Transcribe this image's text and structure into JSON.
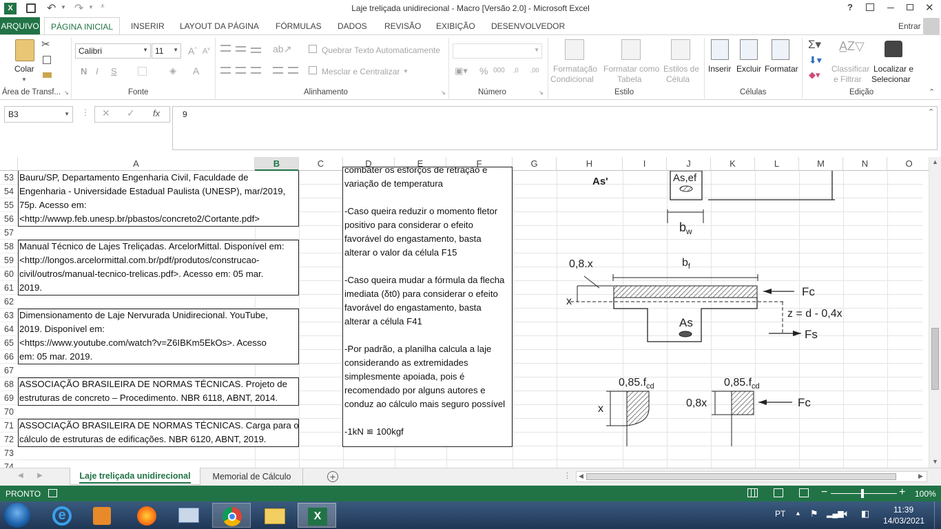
{
  "window": {
    "title": "Laje treliçada unidirecional - Macro [Versão 2.0] - Microsoft Excel",
    "signin": "Entrar"
  },
  "ribbon_tabs": [
    "ARQUIVO",
    "PÁGINA INICIAL",
    "INSERIR",
    "LAYOUT DA PÁGINA",
    "FÓRMULAS",
    "DADOS",
    "REVISÃO",
    "EXIBIÇÃO",
    "DESENVOLVEDOR"
  ],
  "ribbon": {
    "paste": "Colar",
    "font_name": "Calibri",
    "font_size": "11",
    "wrap_text": "Quebrar Texto Automaticamente",
    "merge_center": "Mesclar e Centralizar",
    "bold": "N",
    "italic": "I",
    "underline": "S",
    "cond_format_1": "Formatação",
    "cond_format_2": "Condicional",
    "fmt_table_1": "Formatar como",
    "fmt_table_2": "Tabela",
    "cell_styles_1": "Estilos de",
    "cell_styles_2": "Célula",
    "insert": "Inserir",
    "delete": "Excluir",
    "format": "Formatar",
    "sort_1": "Classificar",
    "sort_2": "e Filtrar",
    "find_1": "Localizar e",
    "find_2": "Selecionar",
    "groups": {
      "clipboard": "Área de Transf...",
      "font": "Fonte",
      "alignment": "Alinhamento",
      "number": "Número",
      "styles": "Estilo",
      "cells": "Células",
      "editing": "Edição"
    }
  },
  "formula_bar": {
    "name_box": "B3",
    "fx": "fx",
    "value": "9"
  },
  "columns": [
    "A",
    "B",
    "C",
    "D",
    "E",
    "F",
    "G",
    "H",
    "I",
    "J",
    "K",
    "L",
    "M",
    "N",
    "O"
  ],
  "rows": [
    "53",
    "54",
    "55",
    "56",
    "57",
    "58",
    "59",
    "60",
    "61",
    "62",
    "63",
    "64",
    "65",
    "66",
    "67",
    "68",
    "69",
    "70",
    "71",
    "72",
    "73",
    "74"
  ],
  "cells_a": [
    "Bauru/SP, Departamento Engenharia Civil, Faculdade de",
    "Engenharia - Universidade Estadual Paulista (UNESP), mar/2019,",
    "75p. Acesso em:",
    "<http://wwwp.feb.unesp.br/pbastos/concreto2/Cortante.pdf>",
    "",
    "Manual Técnico de Lajes Treliçadas. ArcelorMittal. Disponível em:",
    "<http://longos.arcelormittal.com.br/pdf/produtos/construcao-",
    "civil/outros/manual-tecnico-trelicas.pdf>. Acesso em: 05 mar.",
    "2019.",
    "",
    "Dimensionamento de Laje Nervurada Unidirecional. YouTube,",
    "2019. Disponível em:",
    "<https://www.youtube.com/watch?v=Z6IBKm5EkOs>. Acesso",
    "em: 05 mar. 2019.",
    "",
    "ASSOCIAÇÃO BRASILEIRA DE NORMAS TÉCNICAS. Projeto de",
    "estruturas de concreto – Procedimento. NBR 6118, ABNT, 2014.",
    "",
    "ASSOCIAÇÃO BRASILEIRA DE NORMAS TÉCNICAS. Carga para o",
    "cálculo de estruturas de edificações. NBR 6120, ABNT, 2019.",
    ""
  ],
  "notes_box": [
    "combater os esforços de retração e",
    "variação de temperatura",
    "",
    "-Caso queira reduzir o momento fletor",
    "positivo para considerar o efeito",
    "favorável do engastamento, basta",
    "alterar o valor da célula F15",
    "",
    "-Caso queira mudar a fórmula da flecha",
    "imediata (δt0) para considerar o efeito",
    "favorável do engastamento, basta",
    "alterar a célula F41",
    "",
    "-Por padrão, a planilha calcula a laje",
    "considerando as extremidades",
    "simplesmente apoiada, pois é",
    "recomendado por alguns autores e",
    "conduz ao cálculo mais seguro possível",
    "",
    "-1kN ≌ 100kgf"
  ],
  "diagram": {
    "as_prime": "As'",
    "as_ef": "As,ef",
    "bw": "b",
    "bw_sub": "w",
    "x08": "0,8.x",
    "bf": "b",
    "bf_sub": "f",
    "x": "x",
    "fc": "Fc",
    "z": "z = d - 0,4x",
    "as": "As",
    "fs": "Fs",
    "f085a": "0,85.f",
    "f085b": "0,85.f",
    "cd": "cd",
    "x2": "x",
    "x08b": "0,8x",
    "fc2": "Fc"
  },
  "sheet_tabs": {
    "active": "Laje treliçada unidirecional",
    "other": "Memorial de Cálculo"
  },
  "status": {
    "ready": "PRONTO",
    "zoom": "100%"
  },
  "taskbar": {
    "lang": "PT",
    "time": "11:39",
    "date": "14/03/2021"
  }
}
